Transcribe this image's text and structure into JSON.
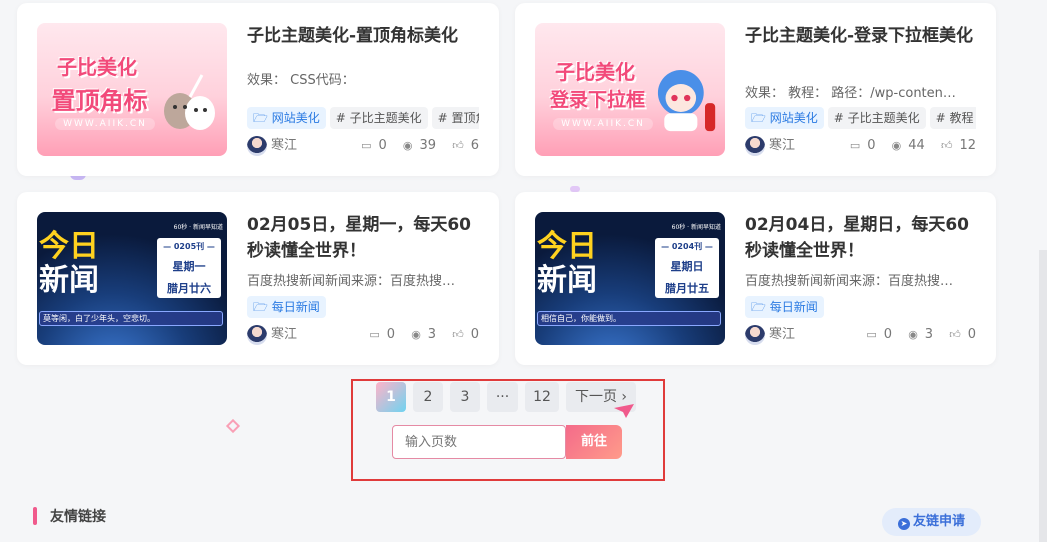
{
  "posts": [
    {
      "title": "子比主题美化-置顶角标美化",
      "excerpt": "效果：  CSS代码：",
      "tags": [
        "网站美化",
        "# 子比主题美化",
        "# 置顶角"
      ],
      "author": "寒江",
      "comments": "0",
      "views": "39",
      "likes": "6",
      "thumb": {
        "line1": "子比美化",
        "line2": "置顶角标",
        "url": "WWW.AIIK.CN"
      }
    },
    {
      "title": "子比主题美化-登录下拉框美化",
      "excerpt": "效果：  教程：  路径：/wp-conten…",
      "tags": [
        "网站美化",
        "# 子比主题美化",
        "# 教程"
      ],
      "author": "寒江",
      "comments": "0",
      "views": "44",
      "likes": "12",
      "thumb": {
        "line1": "子比美化",
        "line2": "登录下拉框",
        "url": "WWW.AIIK.CN"
      }
    },
    {
      "title": "02月05日，星期一，每天60秒读懂全世界！",
      "excerpt": "百度热搜新闻新闻来源：百度热搜…",
      "tags": [
        "每日新闻"
      ],
      "author": "寒江",
      "comments": "0",
      "views": "3",
      "likes": "0",
      "thumb": {
        "big1": "今日",
        "big2": "新闻",
        "hdr": "60秒 · 新闻早知道",
        "issue": "— 0205刊 —",
        "weekday": "星期一",
        "lunar": "腊月廿六",
        "caption": "莫等闲，白了少年头，空悲切。"
      }
    },
    {
      "title": "02月04日，星期日，每天60秒读懂全世界！",
      "excerpt": "百度热搜新闻新闻来源：百度热搜…",
      "tags": [
        "每日新闻"
      ],
      "author": "寒江",
      "comments": "0",
      "views": "3",
      "likes": "0",
      "thumb": {
        "big1": "今日",
        "big2": "新闻",
        "hdr": "60秒 · 新闻早知道",
        "issue": "— 0204刊 —",
        "weekday": "星期日",
        "lunar": "腊月廿五",
        "caption": "相信自己，你能做到。"
      }
    }
  ],
  "pagination": {
    "pages": [
      "1",
      "2",
      "3",
      "···",
      "12"
    ],
    "next": "下一页",
    "input_placeholder": "输入页数",
    "go": "前往"
  },
  "friends": {
    "title": "友情链接",
    "apply": "友链申请"
  },
  "colors": {
    "accent_pink": "#f46b8a",
    "tag_blue": "#2a7ae2",
    "highlight_red": "#e03b3b"
  }
}
